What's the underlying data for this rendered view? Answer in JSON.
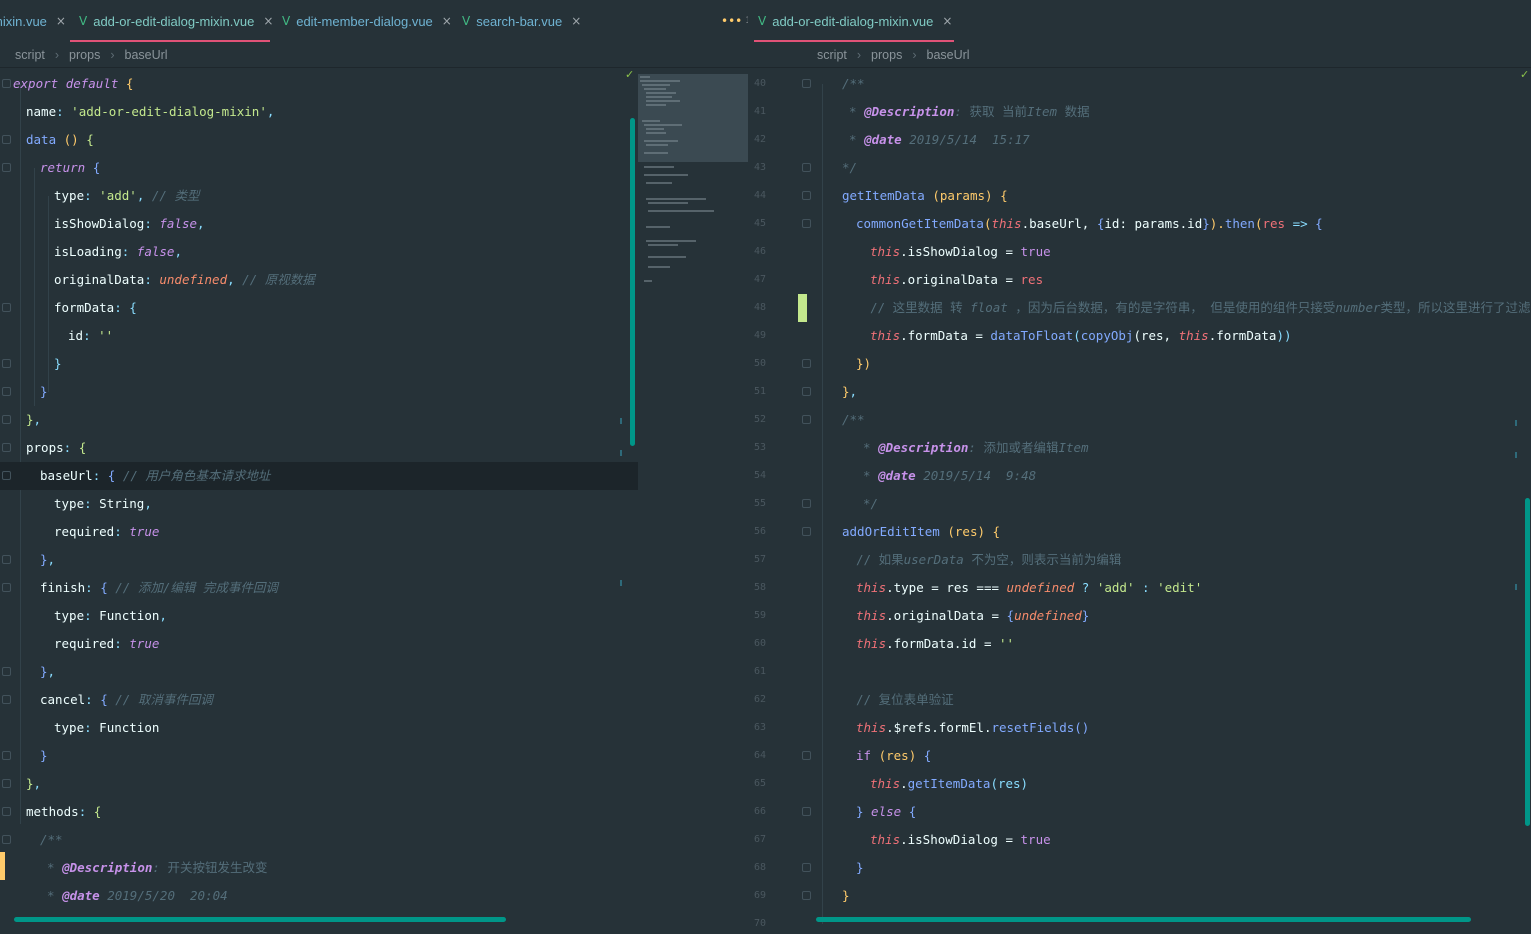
{
  "left": {
    "tabs": [
      {
        "label": "mixin.vue",
        "close": "×",
        "icon": "vue-icon"
      },
      {
        "label": "add-or-edit-dialog-mixin.vue",
        "close": "×",
        "icon": "vue-icon",
        "active": true
      },
      {
        "label": "edit-member-dialog.vue",
        "close": "×",
        "icon": "vue-icon"
      },
      {
        "label": "search-bar.vue",
        "close": "×",
        "icon": "vue-icon"
      }
    ],
    "more": {
      "dots": "•••",
      "count": "1"
    },
    "breadcrumb": [
      "script",
      "props",
      "baseUrl"
    ],
    "code": {
      "l1": {
        "a": "export",
        "b": "default",
        "c": "{"
      },
      "l2": {
        "a": "name",
        "b": ":",
        "c": "'add-or-edit-dialog-mixin'",
        "d": ","
      },
      "l3": {
        "a": "data",
        "b": "()",
        "c": "{"
      },
      "l4": {
        "a": "return",
        "b": "{"
      },
      "l5": {
        "a": "type",
        "b": ":",
        "c": "'add'",
        "d": ",",
        "e": "// 类型"
      },
      "l6": {
        "a": "isShowDialog",
        "b": ":",
        "c": "false",
        "d": ","
      },
      "l7": {
        "a": "isLoading",
        "b": ":",
        "c": "false",
        "d": ","
      },
      "l8": {
        "a": "originalData",
        "b": ":",
        "c": "undefined",
        "d": ",",
        "e": "// 原视数据"
      },
      "l9": {
        "a": "formData",
        "b": ":",
        "c": "{"
      },
      "l10": {
        "a": "id",
        "b": ":",
        "c": "''"
      },
      "l11": {
        "a": "}"
      },
      "l12": {
        "a": "}"
      },
      "l13": {
        "a": "}",
        "b": ","
      },
      "l14": {
        "a": "props",
        "b": ":",
        "c": "{"
      },
      "l15": {
        "a": "baseUrl",
        "b": ":",
        "c": "{",
        "d": "// 用户角色基本请求地址"
      },
      "l16": {
        "a": "type",
        "b": ":",
        "c": "String",
        "d": ","
      },
      "l17": {
        "a": "required",
        "b": ":",
        "c": "true"
      },
      "l18": {
        "a": "}",
        "b": ","
      },
      "l19": {
        "a": "finish",
        "b": ":",
        "c": "{",
        "d": "// 添加/编辑 完成事件回调"
      },
      "l20": {
        "a": "type",
        "b": ":",
        "c": "Function",
        "d": ","
      },
      "l21": {
        "a": "required",
        "b": ":",
        "c": "true"
      },
      "l22": {
        "a": "}",
        "b": ","
      },
      "l23": {
        "a": "cancel",
        "b": ":",
        "c": "{",
        "d": "// 取消事件回调"
      },
      "l24": {
        "a": "type",
        "b": ":",
        "c": "Function"
      },
      "l25": {
        "a": "}"
      },
      "l26": {
        "a": "}",
        "b": ","
      },
      "l27": {
        "a": "methods",
        "b": ":",
        "c": "{"
      },
      "l28": {
        "a": "/**"
      },
      "l29": {
        "a": "*",
        "b": "@Description",
        "c": ":",
        "d": "开关按钮发生改变"
      },
      "l30": {
        "a": "*",
        "b": "@date",
        "c": "2019/5/20  20:04"
      }
    }
  },
  "right": {
    "tabs": [
      {
        "label": "add-or-edit-dialog-mixin.vue",
        "close": "×",
        "icon": "vue-icon",
        "active": true
      }
    ],
    "breadcrumb": [
      "script",
      "props",
      "baseUrl"
    ],
    "line_numbers": [
      "40",
      "41",
      "42",
      "43",
      "44",
      "45",
      "46",
      "47",
      "48",
      "49",
      "50",
      "51",
      "52",
      "53",
      "54",
      "55",
      "56",
      "57",
      "58",
      "59",
      "60",
      "61",
      "62",
      "63",
      "64",
      "65",
      "66",
      "67",
      "68",
      "69",
      "70"
    ],
    "code": {
      "r40": {
        "a": "/**"
      },
      "r41": {
        "a": "*",
        "b": "@Description",
        "c": ":",
        "d": "获取 当前",
        "e": "Item",
        "f": " 数据"
      },
      "r42": {
        "a": "*",
        "b": "@date",
        "c": "2019/5/14  15:17"
      },
      "r43": {
        "a": "*/"
      },
      "r44": {
        "a": "getItemData",
        "b": "(params)",
        "c": "{"
      },
      "r45": {
        "a": "commonGetItemData",
        "b": "(",
        "c": "this",
        "d": ".baseUrl, ",
        "e": "{",
        "f": "id",
        "g": ": params.id",
        "h": "}",
        "i": ").",
        "j": "then",
        "k": "(",
        "l": "res",
        "m": " => ",
        "n": "{"
      },
      "r46": {
        "a": "this",
        "b": ".isShowDialog = ",
        "c": "true"
      },
      "r47": {
        "a": "this",
        "b": ".originalData = ",
        "c": "res"
      },
      "r48": {
        "a": "// 这里数据 转",
        "b": "float",
        "c": "，因为后台数据，有的是字符串， 但是使用的组件只接受",
        "d": "number",
        "e": "类型，所以这里进行了过滤"
      },
      "r49": {
        "a": "this",
        "b": ".formData = ",
        "c": "dataToFloat",
        "d": "(",
        "e": "copyObj",
        "f": "(res, ",
        "g": "this",
        "h": ".formData",
        "i": "))"
      },
      "r50": {
        "a": "})"
      },
      "r51": {
        "a": "}",
        "b": ","
      },
      "r52": {
        "a": "/**"
      },
      "r53": {
        "a": "*",
        "b": "@Description",
        "c": ":",
        "d": "添加或者编辑",
        "e": "Item"
      },
      "r54": {
        "a": "*",
        "b": "@date",
        "c": "2019/5/14  9:48"
      },
      "r55": {
        "a": "*/"
      },
      "r56": {
        "a": "addOrEditItem",
        "b": "(res)",
        "c": "{"
      },
      "r57": {
        "a": "// 如果",
        "b": "userData",
        "c": " 不为空，则表示当前为编辑"
      },
      "r58": {
        "a": "this",
        "b": ".type = res === ",
        "c": "undefined",
        "d": " ? ",
        "e": "'add'",
        "f": " : ",
        "g": "'edit'"
      },
      "r59": {
        "a": "this",
        "b": ".originalData = ",
        "c": "{",
        "d": "undefined",
        "e": "}"
      },
      "r60": {
        "a": "this",
        "b": ".formData.id = ",
        "c": "''"
      },
      "r62": {
        "a": "// 复位表单验证"
      },
      "r63": {
        "a": "this",
        "b": ".$refs.formEl.",
        "c": "resetFields",
        "d": "()"
      },
      "r64": {
        "a": "if",
        "b": " (res) ",
        "c": "{"
      },
      "r65": {
        "a": "this",
        "b": ".",
        "c": "getItemData",
        "d": "(res)"
      },
      "r66": {
        "a": "}",
        "b": " else ",
        "c": "{"
      },
      "r67": {
        "a": "this",
        "b": ".isShowDialog = ",
        "c": "true"
      },
      "r68": {
        "a": "}"
      },
      "r69": {
        "a": "}"
      }
    }
  },
  "colors": {
    "background": "#263238",
    "accent": "#80cbc4",
    "active_tab_underline": "#e05277",
    "scrollbar": "#009688",
    "vue": "#41b883"
  }
}
